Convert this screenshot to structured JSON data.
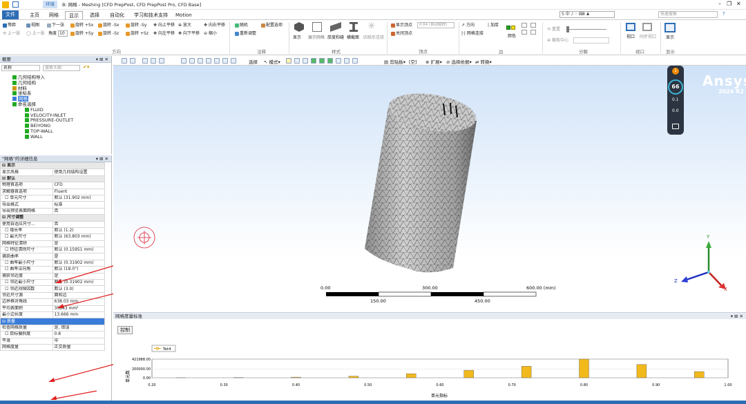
{
  "window": {
    "title": "B: 网格 - Meshing [CFD PrepPost, CFD PrepPost Pro, CFD Base]",
    "context_tab": "环境"
  },
  "tabs": [
    "文件",
    "主页",
    "网格",
    "显示",
    "选择",
    "自动化",
    "学习和技术支持",
    "Motion"
  ],
  "search_placeholder": "快速搜索",
  "ribbon": {
    "direction_group": {
      "label": "方向",
      "items": [
        "等距",
        "视图",
        "下一张",
        "上一张",
        "角度",
        "旋转 +Sx",
        "旋转 +Sy",
        "旋转 -Sx",
        "旋转 -Sy",
        "旋转 -Sz",
        "旋转 +Sz",
        "向上平移",
        "向左平移",
        "向下平移",
        "向右平移",
        "放大",
        "缩小"
      ],
      "angle_value": "10"
    },
    "annotation_group": {
      "label": "注释",
      "items": [
        "随机",
        "配置选项",
        "重新调整"
      ]
    },
    "style_group": {
      "label": "样式",
      "items": [
        "显示",
        "展示网格",
        "厚度和缝",
        "横截面",
        "四棱形连接"
      ]
    },
    "vertex_group": {
      "label": "顶点",
      "items": [
        "显示顶点",
        "关闭顶点"
      ],
      "auto_placeholder": "0.64 (自动缩放)"
    },
    "edge_group": {
      "label": "边",
      "items": [
        "方向",
        "加厚",
        "网格连接",
        "颜色"
      ]
    },
    "split_group": {
      "label": "分解",
      "items": [
        "重置",
        "截取中心"
      ]
    },
    "viewport_group": {
      "label": "视口",
      "items": [
        "视口",
        "同步视口"
      ]
    },
    "display_group": {
      "label": "显示",
      "items": [
        "显示"
      ]
    }
  },
  "outline": {
    "header": "概要",
    "name_label": "名称",
    "search_placeholder": "搜索大纲",
    "items": [
      {
        "label": "几何结构导入",
        "indent": 0
      },
      {
        "label": "几何结构",
        "indent": 0
      },
      {
        "label": "材料",
        "indent": 0
      },
      {
        "label": "坐标系",
        "indent": 0
      },
      {
        "label": "网格",
        "indent": 0
      },
      {
        "label": "命名选择",
        "indent": 0
      },
      {
        "label": "FLUID",
        "indent": 1
      },
      {
        "label": "VELOCITY-INLET",
        "indent": 1
      },
      {
        "label": "PRESSURE-OUTLET",
        "indent": 1
      },
      {
        "label": "BEIYONG",
        "indent": 1
      },
      {
        "label": "TOP-WALL",
        "indent": 1
      },
      {
        "label": "WALL",
        "indent": 1
      }
    ]
  },
  "details": {
    "header": "\"网格\"的详细信息",
    "rows": [
      {
        "k": "显示",
        "v": "",
        "type": "sec"
      },
      {
        "k": "显示风格",
        "v": "使用几何结构设置"
      },
      {
        "k": "默认",
        "v": "",
        "type": "sec"
      },
      {
        "k": "物理首选项",
        "v": "CFD"
      },
      {
        "k": "求解器首选项",
        "v": "Fluent"
      },
      {
        "k": "单元尺寸",
        "v": "默认 (31.902 mm)",
        "chk": true
      },
      {
        "k": "导出格式",
        "v": "标准"
      },
      {
        "k": "导出预览表面网格",
        "v": "否"
      },
      {
        "k": "尺寸调整",
        "v": "",
        "type": "sec"
      },
      {
        "k": "使用自适应尺寸...",
        "v": "否"
      },
      {
        "k": "增长率",
        "v": "默认 (1.2)",
        "chk": true
      },
      {
        "k": "最大尺寸",
        "v": "默认 (63.803 mm)",
        "chk": true
      },
      {
        "k": "网格特征清除",
        "v": "是"
      },
      {
        "k": "特征清除尺寸",
        "v": "默认 (0.15951 mm)",
        "chk": true
      },
      {
        "k": "捕获曲率",
        "v": "是"
      },
      {
        "k": "曲率最小尺寸",
        "v": "默认 (0.31902 mm)",
        "chk": true
      },
      {
        "k": "曲率法向角",
        "v": "默认 (18.0°)",
        "chk": true
      },
      {
        "k": "捕获邻近度",
        "v": "是"
      },
      {
        "k": "邻近最小尺寸",
        "v": "默认 (0.31902 mm)",
        "chk": true
      },
      {
        "k": "邻近间隙因数",
        "v": "默认 (3.0)",
        "chk": true
      },
      {
        "k": "邻近尺寸源",
        "v": "面和边"
      },
      {
        "k": "边界框对角线",
        "v": "638.03 mm"
      },
      {
        "k": "平均表面积",
        "v": "30843 mm²"
      },
      {
        "k": "最小边长度",
        "v": "13.666 mm"
      },
      {
        "k": "质量",
        "v": "",
        "type": "hl"
      },
      {
        "k": "检查网格质量",
        "v": "是, 错误"
      },
      {
        "k": "目标偏斜度",
        "v": "0.8",
        "chk": true
      },
      {
        "k": "平滑",
        "v": "中"
      },
      {
        "k": "网格度量",
        "v": "正交质量"
      }
    ]
  },
  "viewport": {
    "toolbar_items": [
      "选择",
      "模式",
      "剪贴板",
      "[空]",
      "扩展",
      "选择依据",
      "转换"
    ],
    "brand": "Ansys",
    "version": "2024 R2",
    "hud": {
      "badge": "1",
      "fps": "66",
      "stat1": "0.1",
      "stat2": "0.0"
    },
    "scale": {
      "ticks": [
        "0.00",
        "300.00",
        "600.00 (mm)"
      ],
      "sub_ticks": [
        "150.00",
        "450.00"
      ]
    },
    "axis_labels": {
      "x": "X",
      "y": "Y",
      "z": "Z"
    }
  },
  "graph_panel": {
    "title": "网格度量标准",
    "control_button": "控制",
    "legend": "Tet4",
    "ylabel": "单元数",
    "xlabel": "单元指标"
  },
  "chart_data": {
    "type": "bar",
    "title": "",
    "xlabel": "单元指标",
    "ylabel": "单元数",
    "xlim": [
      0.2,
      1.0
    ],
    "ylim": [
      0,
      421988
    ],
    "x_ticks": [
      "0.20",
      "0.30",
      "0.40",
      "0.50",
      "0.60",
      "0.70",
      "0.80",
      "0.90",
      "1.00"
    ],
    "y_ticks": [
      "0.00",
      "200000.00",
      "421988.00"
    ],
    "series": [
      {
        "name": "Tet4",
        "x": [
          0.24,
          0.32,
          0.4,
          0.48,
          0.56,
          0.64,
          0.72,
          0.8,
          0.88,
          0.96
        ],
        "values": [
          1200,
          3500,
          14000,
          36000,
          92000,
          170000,
          260000,
          421988,
          300000,
          140000
        ]
      }
    ],
    "bar_color": "#f2b91d"
  }
}
